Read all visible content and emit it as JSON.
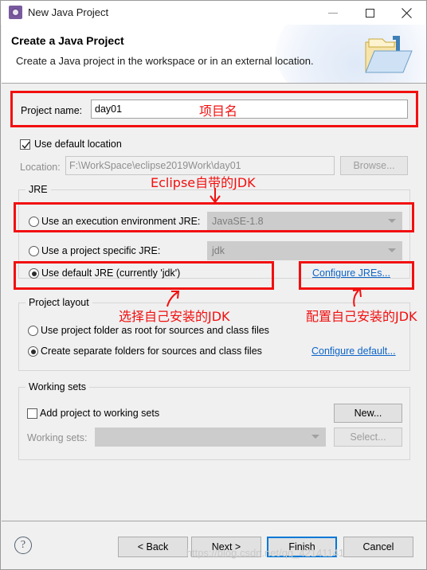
{
  "window": {
    "title": "New Java Project",
    "icon": "eclipse-wizard-icon",
    "minimize_label": "—",
    "maximize_label": "□",
    "close_label": "✕"
  },
  "header": {
    "title": "Create a Java Project",
    "description": "Create a Java project in the workspace or in an external location.",
    "banner_icon": "java-project-folder-icon"
  },
  "project": {
    "name_label": "Project name:",
    "name_value": "day01",
    "use_default_location_label": "Use default location",
    "use_default_location_checked": true,
    "location_label": "Location:",
    "location_value": "F:\\WorkSpace\\eclipse2019Work\\day01",
    "browse_label": "Browse..."
  },
  "jre": {
    "group_title": "JRE",
    "execution_env_label": "Use an execution environment JRE:",
    "execution_env_value": "JavaSE-1.8",
    "execution_env_selected": false,
    "project_specific_label": "Use a project specific JRE:",
    "project_specific_value": "jdk",
    "project_specific_selected": false,
    "default_jre_label": "Use default JRE (currently 'jdk')",
    "default_jre_selected": true,
    "configure_jres_link": "Configure JREs..."
  },
  "project_layout": {
    "group_title": "Project layout",
    "option_root_label": "Use project folder as root for sources and class files",
    "option_root_selected": false,
    "option_separate_label": "Create separate folders for sources and class files",
    "option_separate_selected": true,
    "configure_default_link": "Configure default..."
  },
  "working_sets": {
    "group_title": "Working sets",
    "add_project_label": "Add project to working sets",
    "add_project_checked": false,
    "working_sets_label": "Working sets:",
    "working_sets_value": "",
    "new_label": "New...",
    "select_label": "Select..."
  },
  "footer": {
    "help_label": "?",
    "back_label": "< Back",
    "next_label": "Next >",
    "finish_label": "Finish",
    "cancel_label": "Cancel"
  },
  "annotations": {
    "color": "#f20f0f",
    "project_name": "项目名",
    "eclipse_jdk": "Eclipse自带的JDK",
    "select_own_jdk": "选择自己安装的JDK",
    "configure_own_jdk": "配置自己安装的JDK"
  },
  "watermark": {
    "text": "https://blog.csdn.net/qq_42141141"
  }
}
